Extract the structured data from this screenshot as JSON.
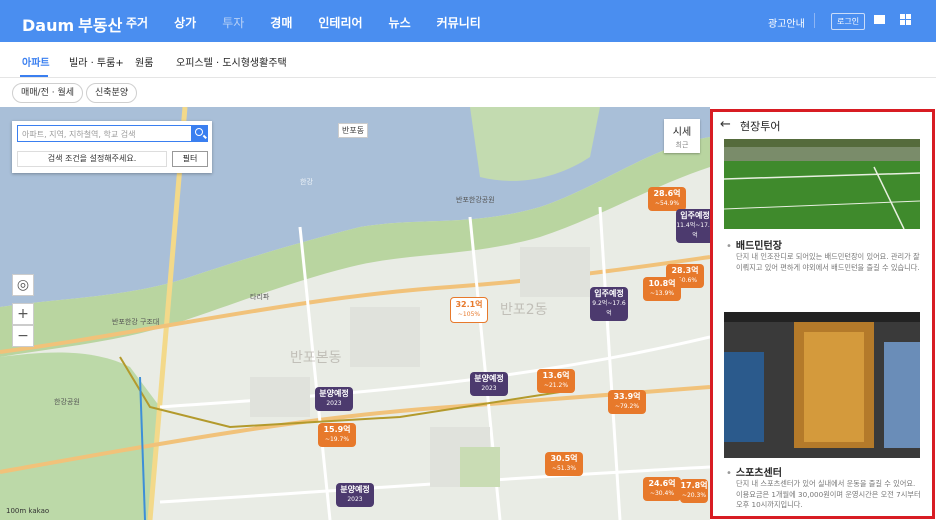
{
  "header": {
    "logo_brand": "Daum",
    "logo_service": "부동산",
    "nav": [
      {
        "label": "주거",
        "state": "active"
      },
      {
        "label": "상가",
        "state": "normal"
      },
      {
        "label": "투자",
        "state": "dim"
      },
      {
        "label": "경매",
        "state": "normal"
      },
      {
        "label": "인테리어",
        "state": "normal"
      },
      {
        "label": "뉴스",
        "state": "normal"
      },
      {
        "label": "커뮤니티",
        "state": "normal"
      }
    ],
    "ad_link": "광고안내",
    "login": "로그인",
    "icons": [
      "mail-icon",
      "app-grid-icon"
    ]
  },
  "subnav": {
    "tabs": [
      "아파트",
      "빌라 · 투룸+",
      "원룸",
      "오피스텔 · 도시형생활주택"
    ],
    "active_index": 0
  },
  "filters": [
    "매매/전 · 월세",
    "신축분양"
  ],
  "map": {
    "search_placeholder": "아파트, 지역, 지하철역, 학교 검색",
    "search_status": "검색 조건을 설정해주세요.",
    "filter_label": "필터",
    "sise_label": "시세",
    "sise_sub": "최근",
    "zoom_in": "+",
    "zoom_out": "−",
    "scale_text": "100m",
    "kakao": "kakao",
    "labels": {
      "banpo_dong": "반포동",
      "banpo_bonbon": "반포본동",
      "banpo_2": "반포2동",
      "hangang_park": "한강공원",
      "banpo_park": "반포한강공원",
      "hangang": "한강",
      "tari_park": "타리파",
      "gujeong": "반포한강 구조대"
    },
    "pins": [
      {
        "price": "28.6억",
        "change": "~54.9%",
        "style": "orange"
      },
      {
        "price": "입주예정",
        "change": "11.4억~17.2억",
        "style": "purple"
      },
      {
        "price": "28.3억",
        "change": "~50.6%",
        "style": "orange"
      },
      {
        "price": "10.8억",
        "change": "~13.9%",
        "style": "orange"
      },
      {
        "price": "입주예정",
        "change": "9.2억~17.6억",
        "style": "purple"
      },
      {
        "price": "32.1억",
        "change": "~105%",
        "style": "white"
      },
      {
        "price": "13.6억",
        "change": "~21.2%",
        "style": "orange"
      },
      {
        "price": "분양예정",
        "change": "2023",
        "style": "purple"
      },
      {
        "price": "분양예정",
        "change": "2023",
        "style": "purple"
      },
      {
        "price": "33.9억",
        "change": "~79.2%",
        "style": "orange"
      },
      {
        "price": "15.9억",
        "change": "~19.7%",
        "style": "orange"
      },
      {
        "price": "30.5억",
        "change": "~51.3%",
        "style": "orange"
      },
      {
        "price": "분양예정",
        "change": "2023",
        "style": "purple"
      },
      {
        "price": "24.6억",
        "change": "~30.4%",
        "style": "orange"
      },
      {
        "price": "17.8억",
        "change": "~20.3%",
        "style": "orange"
      }
    ]
  },
  "panel": {
    "title": "현장투어",
    "sections": [
      {
        "title": "배드민턴장",
        "desc": "단지 내 인조잔디로 되어있는 배드민턴장이 있어요. 관리가 잘 이뤄지고 있어 편하게 야외에서 배드민턴을 즐길 수 있습니다."
      },
      {
        "title": "스포츠센터",
        "desc": "단지 내 스포츠센터가 있어 실내에서 운동을 즐길 수 있어요. 이용요금은 1개월에 30,000원이며 운영시간은 오전 7시부터 오후 10시까지입니다."
      }
    ]
  }
}
